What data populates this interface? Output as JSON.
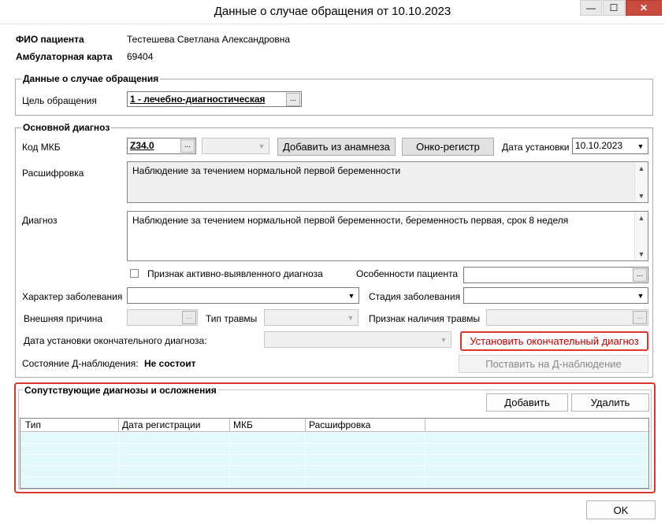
{
  "window": {
    "title": "Данные о случае обращения от 10.10.2023",
    "minimize_glyph": "—",
    "maximize_glyph": "☐",
    "close_glyph": "✕"
  },
  "patient": {
    "fio_label": "ФИО пациента",
    "fio_value": "Тестешева Светлана Александровна",
    "card_label": "Амбулаторная карта",
    "card_value": "69404"
  },
  "case_group": {
    "legend": "Данные о случае обращения",
    "purpose_label": "Цель обращения",
    "purpose_value": "1 - лечебно-диагностическая"
  },
  "main_diag": {
    "legend": "Основной диагноз",
    "mkb_label": "Код МКБ",
    "mkb_value": "Z34.0",
    "add_from_anamnesis": "Добавить из анамнеза",
    "onko_register": "Онко-регистр",
    "date_label": "Дата установки",
    "date_value": "10.10.2023",
    "decoding_label": "Расшифровка",
    "decoding_value": "Наблюдение за течением нормальной первой беременности",
    "diagnosis_label": "Диагноз",
    "diagnosis_value": "Наблюдение за течением нормальной первой беременности, беременность первая, срок 8 неделя",
    "active_flag_label": "Признак активно-выявленного диагноза",
    "patient_features_label": "Особенности пациента",
    "disease_nature_label": "Характер заболевания",
    "disease_stage_label": "Стадия заболевания",
    "external_cause_label": "Внешняя причина",
    "trauma_type_label": "Тип травмы",
    "trauma_presence_label": "Признак наличия травмы",
    "final_date_label": "Дата установки окончательного диагноза:",
    "set_final_button": "Установить окончательный диагноз",
    "d_status_label": "Состояние Д-наблюдения:",
    "d_status_value": "Не состоит",
    "put_on_d_button": "Поставить на Д-наблюдение"
  },
  "concomitant": {
    "legend": "Сопутствующие диагнозы и осложнения",
    "add_button": "Добавить",
    "delete_button": "Удалить",
    "columns": [
      "Тип",
      "Дата регистрации",
      "МКБ",
      "Расшифровка"
    ],
    "rows": [
      [],
      [],
      [],
      [],
      []
    ]
  },
  "footer": {
    "ok_button": "OK"
  },
  "icons": {
    "ellipsis": "...",
    "dropdown": "▼",
    "scroll_up": "▲",
    "scroll_down": "▼"
  },
  "colors": {
    "highlight_red": "#d9372e",
    "grid_row": "#e2fafb"
  }
}
